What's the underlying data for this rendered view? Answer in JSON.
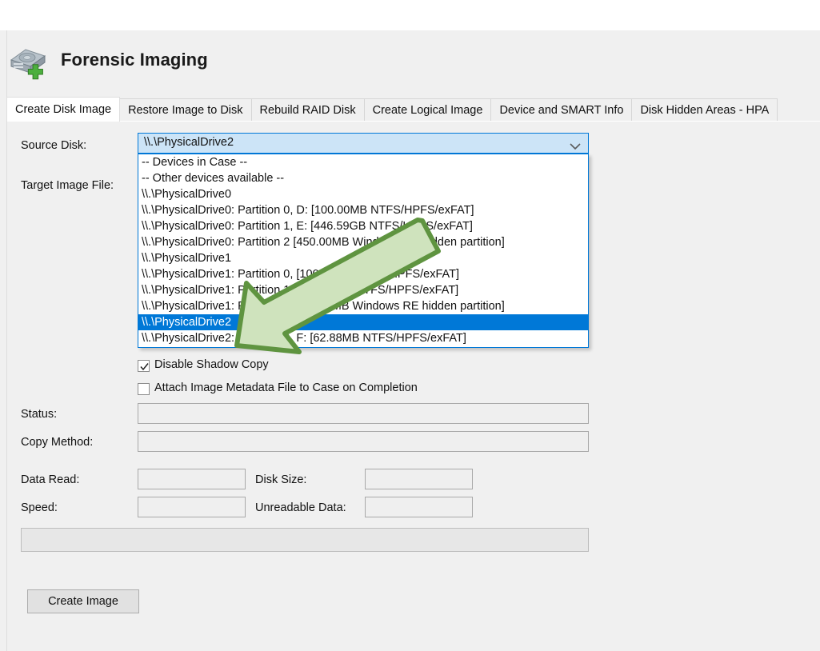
{
  "header": {
    "title": "Forensic Imaging",
    "icon": "hard-disk-add-icon"
  },
  "tabs": [
    {
      "label": "Create Disk Image",
      "active": true
    },
    {
      "label": "Restore Image to Disk",
      "active": false
    },
    {
      "label": "Rebuild RAID Disk",
      "active": false
    },
    {
      "label": "Create Logical Image",
      "active": false
    },
    {
      "label": "Device and SMART Info",
      "active": false
    },
    {
      "label": "Disk Hidden Areas - HPA",
      "active": false
    }
  ],
  "form": {
    "source_disk_label": "Source Disk:",
    "target_image_file_label": "Target Image File:",
    "status_label": "Status:",
    "copy_method_label": "Copy Method:",
    "data_read_label": "Data Read:",
    "disk_size_label": "Disk Size:",
    "speed_label": "Speed:",
    "unreadable_data_label": "Unreadable Data:",
    "status_value": "",
    "copy_method_value": "",
    "data_read_value": "",
    "disk_size_value": "",
    "speed_value": "",
    "unreadable_data_value": ""
  },
  "source_disk_combo": {
    "selected_value": "\\\\.\\PhysicalDrive2",
    "expanded": true,
    "arrow_icon": "chevron-down-icon",
    "options": [
      {
        "label": "-- Devices in Case --",
        "selected": false
      },
      {
        "label": "-- Other devices available --",
        "selected": false
      },
      {
        "label": "\\\\.\\PhysicalDrive0",
        "selected": false
      },
      {
        "label": "\\\\.\\PhysicalDrive0: Partition 0, D: [100.00MB NTFS/HPFS/exFAT]",
        "selected": false
      },
      {
        "label": "\\\\.\\PhysicalDrive0: Partition 1, E: [446.59GB NTFS/HPFS/exFAT]",
        "selected": false
      },
      {
        "label": "\\\\.\\PhysicalDrive0: Partition 2 [450.00MB Windows RE hidden partition]",
        "selected": false
      },
      {
        "label": "\\\\.\\PhysicalDrive1",
        "selected": false
      },
      {
        "label": "\\\\.\\PhysicalDrive1: Partition 0, [100.00MB NTFS/HPFS/exFAT]",
        "selected": false
      },
      {
        "label": "\\\\.\\PhysicalDrive1: Partition 1, [223.03GB NTFS/HPFS/exFAT]",
        "selected": false
      },
      {
        "label": "\\\\.\\PhysicalDrive1: Partition 2 [450.00MB Windows RE hidden partition]",
        "selected": false
      },
      {
        "label": "\\\\.\\PhysicalDrive2",
        "selected": true
      },
      {
        "label": "\\\\.\\PhysicalDrive2: Partition 0, F: [62.88MB NTFS/HPFS/exFAT]",
        "selected": false
      }
    ]
  },
  "checkboxes": [
    {
      "label": "Disable Shadow Copy",
      "checked": true
    },
    {
      "label": "Attach Image Metadata File to Case on Completion",
      "checked": false
    }
  ],
  "actions": {
    "create_image_label": "Create Image"
  },
  "annotation": {
    "arrow_icon": "green-arrow-pointing-down-left",
    "fill_color": "#cfe3bd",
    "stroke_color": "#5f9440"
  },
  "colors": {
    "accent": "#0078d7",
    "selection_bg": "#0078d7",
    "panel_bg": "#f0f0f0",
    "combo_bg": "#cce4f7"
  }
}
